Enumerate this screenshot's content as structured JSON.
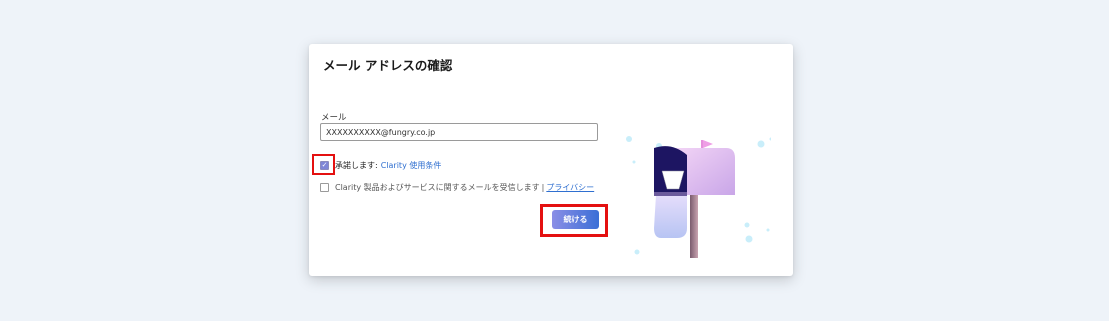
{
  "dialog": {
    "title": "メール アドレスの確認",
    "email_label": "メール",
    "email_value": "XXXXXXXXXX@fungry.co.jp",
    "terms_prefix": "承諾します:",
    "terms_link": "Clarity 使用条件",
    "terms_checked": true,
    "mail_opt_text": "Clarity 製品およびサービスに関するメールを受信します",
    "separator": "|",
    "privacy_link": "プライバシー",
    "mail_opt_checked": false,
    "continue_label": "続ける"
  },
  "colors": {
    "accent_start": "#8a8ee6",
    "accent_end": "#3b6fd6",
    "highlight": "#e41010",
    "link": "#2f6fd0",
    "mailbox": "#e6bff0"
  },
  "illustration": {
    "icon": "mailbox-icon"
  }
}
